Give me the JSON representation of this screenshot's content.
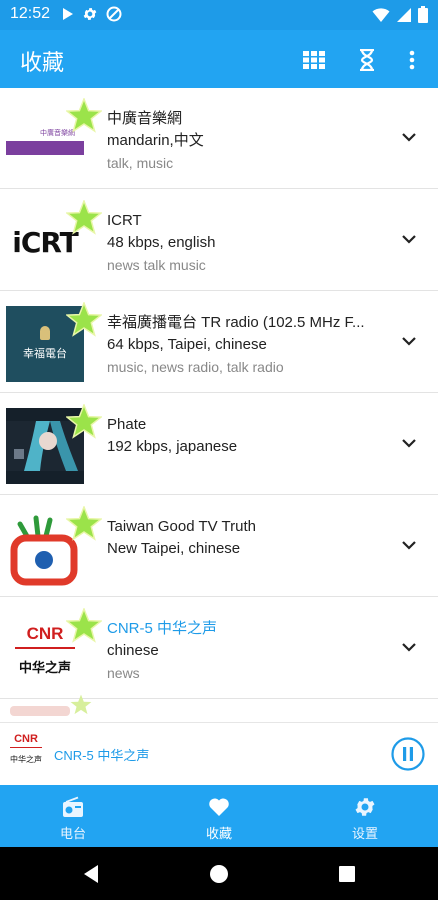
{
  "status_bar": {
    "time": "12:52"
  },
  "app_bar": {
    "title": "收藏",
    "actions": [
      "grid-view-icon",
      "hourglass-icon",
      "more-vert-icon"
    ]
  },
  "stations": [
    {
      "name": "中廣音樂網",
      "info": "mandarin,中文",
      "tags": "talk, music",
      "favorite": true
    },
    {
      "name": "ICRT",
      "info": "48 kbps, english",
      "tags": "news talk music",
      "favorite": true
    },
    {
      "name": "幸福廣播電台 TR radio (102.5 MHz F...",
      "info": "64 kbps, Taipei, chinese",
      "tags": "music, news radio, talk radio",
      "favorite": true
    },
    {
      "name": "Phate",
      "info": "192 kbps, japanese",
      "tags": "",
      "favorite": true
    },
    {
      "name": "Taiwan Good TV Truth",
      "info": "New Taipei, chinese",
      "tags": "",
      "favorite": true
    },
    {
      "name": "CNR-5 中华之声",
      "info": "chinese",
      "tags": "news",
      "favorite": true,
      "playing": true
    }
  ],
  "logos": {
    "zhongguang": "中廣音樂網",
    "icrt": "iCRT",
    "happy": "幸福電台",
    "cnr": "CNR",
    "cnr_sub": "中华之声"
  },
  "player": {
    "title": "CNR-5 中华之声"
  },
  "bottom_nav": [
    {
      "label": "电台",
      "icon": "radio-icon"
    },
    {
      "label": "收藏",
      "icon": "heart-icon"
    },
    {
      "label": "设置",
      "icon": "gear-icon"
    }
  ],
  "colors": {
    "primary": "#22a4f2",
    "accent_text": "#1e9be8",
    "star": "#9be34a"
  }
}
